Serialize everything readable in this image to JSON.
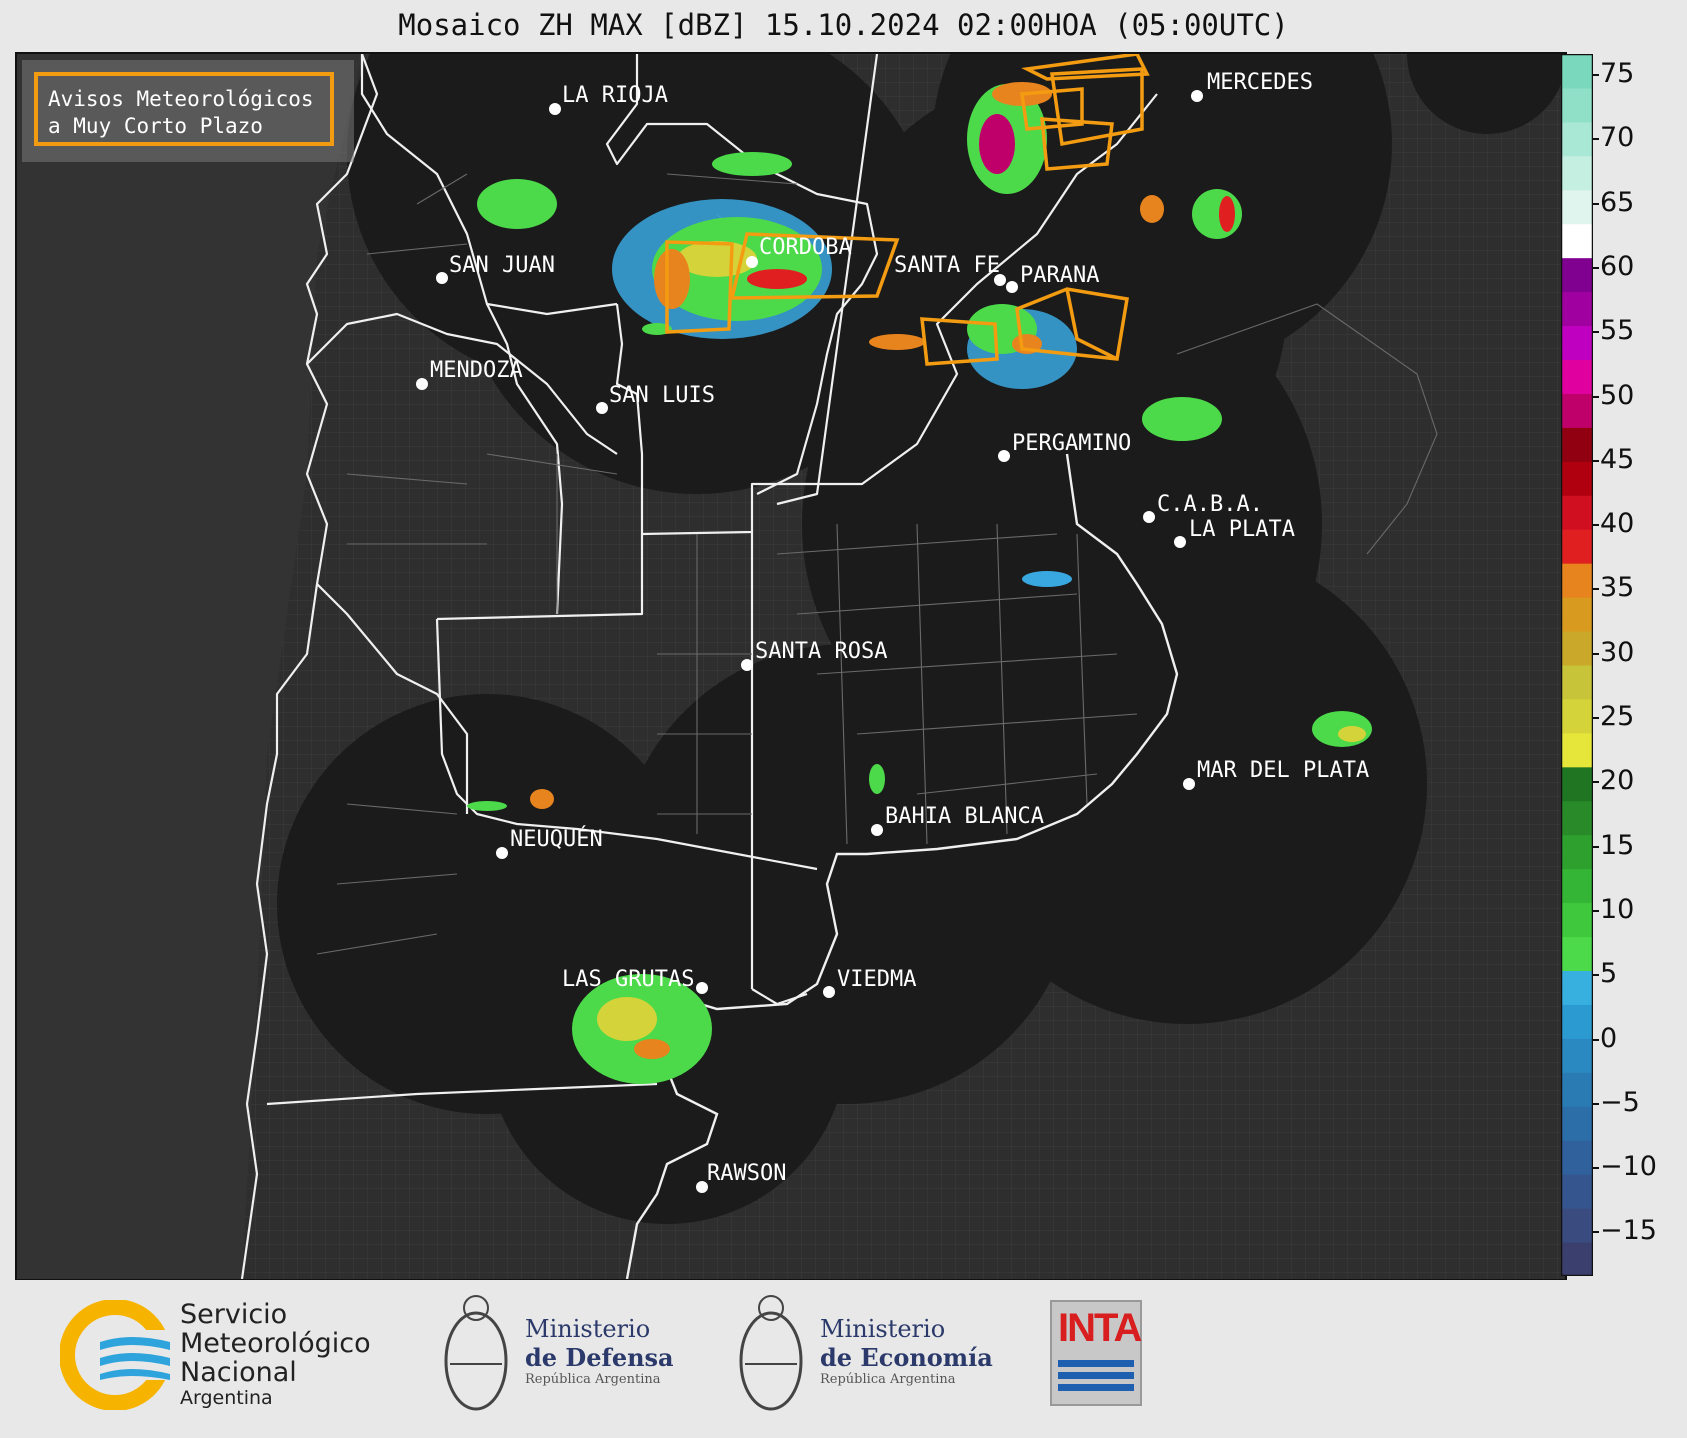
{
  "title": "Mosaico ZH MAX [dBZ] 15.10.2024 02:00HOA (05:00UTC)",
  "legend": {
    "line1": "Avisos Meteorológicos",
    "line2": "a Muy Corto Plazo",
    "color": "#f39c12"
  },
  "colorbar": {
    "ticks": [
      "75",
      "70",
      "65",
      "60",
      "55",
      "50",
      "45",
      "40",
      "35",
      "30",
      "25",
      "20",
      "15",
      "10",
      "5",
      "0",
      "−5",
      "−10",
      "−15"
    ],
    "colors": [
      "#3b3f6e",
      "#3a4b80",
      "#35558f",
      "#31619c",
      "#2c6ea8",
      "#2a7bb4",
      "#2a89c0",
      "#2b9ad0",
      "#37b0e0",
      "#4cd94a",
      "#3fc83d",
      "#35b535",
      "#2ea02e",
      "#288a28",
      "#207522",
      "#e5e53a",
      "#d4d43a",
      "#c8c43a",
      "#c9a82a",
      "#d99a20",
      "#e8841d",
      "#e02020",
      "#d01020",
      "#b00010",
      "#900010",
      "#c0006a",
      "#e000a0",
      "#c000c0",
      "#a000a0",
      "#800090",
      "#ffffff",
      "#e0f5ee",
      "#c5efe0",
      "#a8e8d4",
      "#90e0c8",
      "#7ad8bc"
    ]
  },
  "cities": [
    {
      "name": "LA RIOJA"
    },
    {
      "name": "MERCEDES"
    },
    {
      "name": "CORDOBA"
    },
    {
      "name": "SAN JUAN"
    },
    {
      "name": "SANTA FE"
    },
    {
      "name": "PARANA"
    },
    {
      "name": "MENDOZA"
    },
    {
      "name": "SAN LUIS"
    },
    {
      "name": "PERGAMINO"
    },
    {
      "name": "C.A.B.A."
    },
    {
      "name": "LA PLATA"
    },
    {
      "name": "SANTA ROSA"
    },
    {
      "name": "MAR DEL PLATA"
    },
    {
      "name": "BAHIA BLANCA"
    },
    {
      "name": "NEUQUÉN"
    },
    {
      "name": "LAS GRUTAS"
    },
    {
      "name": "VIEDMA"
    },
    {
      "name": "RAWSON"
    }
  ],
  "footer": {
    "smn_l1": "Servicio",
    "smn_l2": "Meteorológico",
    "smn_l3": "Nacional",
    "smn_l4": "Argentina",
    "def_l1": "Ministerio",
    "def_l2": "de Defensa",
    "def_l3": "República Argentina",
    "eco_l1": "Ministerio",
    "eco_l2": "de Economía",
    "eco_l3": "República Argentina",
    "inta": "INTA"
  }
}
